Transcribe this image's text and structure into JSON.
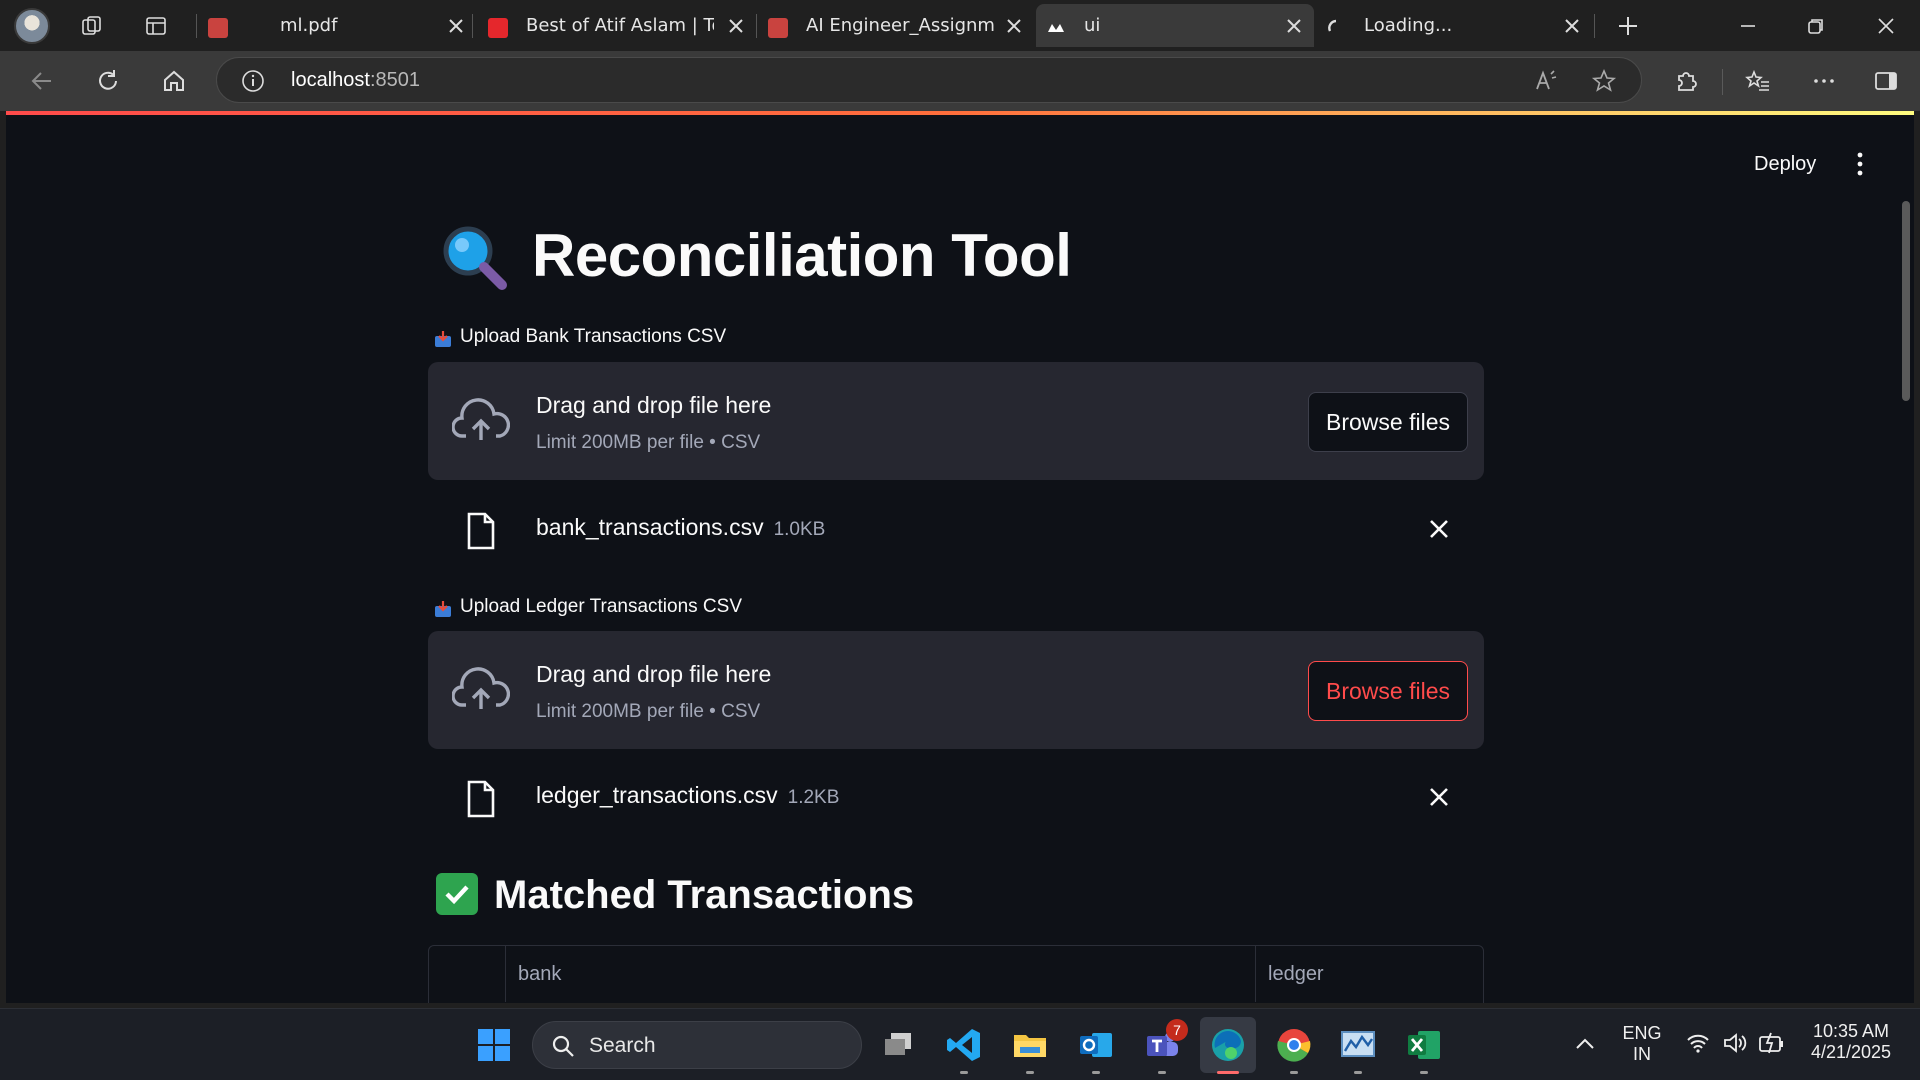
{
  "browser": {
    "tabs": [
      {
        "title": "ml.pdf",
        "favicon": "pdf-icon"
      },
      {
        "title": "Best of Atif Aslam | Top",
        "favicon": "youtube-icon"
      },
      {
        "title": "AI Engineer_Assignmen",
        "favicon": "pdf-icon"
      },
      {
        "title": "ui",
        "favicon": "streamlit-icon",
        "active": true
      },
      {
        "title": "Loading...",
        "favicon": "loading-icon"
      }
    ],
    "url_host": "localhost",
    "url_port": ":8501"
  },
  "app": {
    "deploy_label": "Deploy",
    "title": "Reconciliation Tool",
    "title_icon": "magnifier-icon",
    "bank_uploader": {
      "label": "Upload Bank Transactions CSV",
      "drop_title": "Drag and drop file here",
      "drop_sub": "Limit 200MB per file • CSV",
      "browse_label": "Browse files",
      "file_name": "bank_transactions.csv",
      "file_size": "1.0KB"
    },
    "ledger_uploader": {
      "label": "Upload Ledger Transactions CSV",
      "drop_title": "Drag and drop file here",
      "drop_sub": "Limit 200MB per file • CSV",
      "browse_label": "Browse files",
      "file_name": "ledger_transactions.csv",
      "file_size": "1.2KB"
    },
    "matched_heading": "Matched Transactions",
    "table_columns": [
      "",
      "bank",
      "ledger"
    ]
  },
  "taskbar": {
    "search_placeholder": "Search",
    "teams_badge": "7",
    "lang_line1": "ENG",
    "lang_line2": "IN",
    "time": "10:35 AM",
    "date": "4/21/2025"
  },
  "colors": {
    "accent": "#ff4b4b",
    "page_bg": "#0e1117",
    "surface": "#262730"
  }
}
